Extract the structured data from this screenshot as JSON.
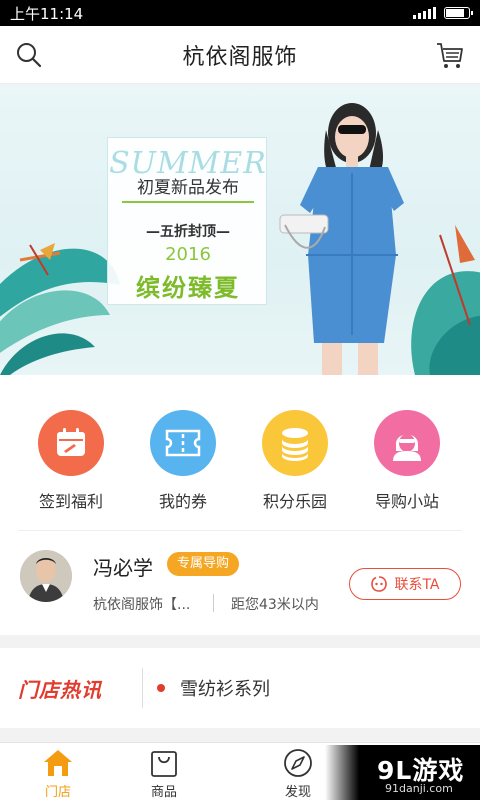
{
  "status_bar": {
    "time": "上午11:14",
    "battery_level": 0.9
  },
  "nav": {
    "title": "杭依阁服饰",
    "search_icon": "search-icon",
    "cart_icon": "cart-icon"
  },
  "banner": {
    "summer_text": "SUMMER",
    "title": "初夏新品发布",
    "subtitle": "—五折封顶—",
    "year": "2016",
    "slogan": "缤纷臻夏",
    "accent_color": "#8cc63f"
  },
  "quick_menu": [
    {
      "label": "签到福利",
      "icon": "calendar-icon",
      "color": "#f26b4a"
    },
    {
      "label": "我的券",
      "icon": "ticket-icon",
      "color": "#58b4ee"
    },
    {
      "label": "积分乐园",
      "icon": "coin-stack-icon",
      "color": "#fbc73a"
    },
    {
      "label": "导购小站",
      "icon": "shop-assistant-icon",
      "color": "#f26da1"
    }
  ],
  "guide": {
    "name": "冯必学",
    "badge": "专属导购",
    "store": "杭依阁服饰【...",
    "distance": "距您43米以内",
    "contact_label": "联系TA"
  },
  "news": {
    "logo": "门店热讯",
    "text": "雪纺衫系列"
  },
  "tabs": [
    {
      "label": "门店",
      "icon": "home-icon",
      "active": true
    },
    {
      "label": "商品",
      "icon": "shopping-bag-icon",
      "active": false
    },
    {
      "label": "发现",
      "icon": "compass-icon",
      "active": false
    }
  ],
  "watermark": {
    "main": "9L游戏",
    "sub": "91danji.com"
  }
}
